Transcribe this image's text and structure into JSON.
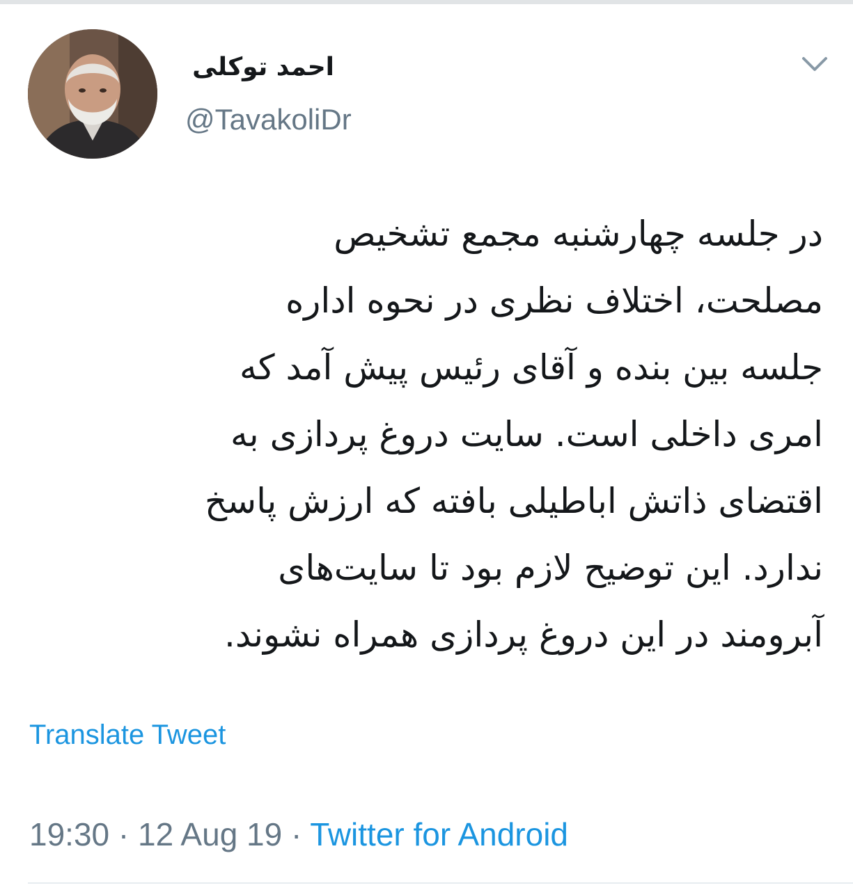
{
  "user": {
    "display_name": "احمد توکلی",
    "handle": "@TavakoliDr"
  },
  "tweet": {
    "lines": [
      "در جلسه چهارشنبه مجمع تشخیص",
      "مصلحت، اختلاف نظری در نحوه اداره",
      "جلسه بین بنده و آقای رئیس  پیش آمد که",
      "امری داخلی است. سایت دروغ پردازی به",
      "اقتضای ذاتش اباطیلی بافته که ارزش پاسخ",
      "ندارد. این توضیح لازم بود تا سایت‌های",
      "آبرومند در این دروغ پردازی همراه نشوند."
    ],
    "translate_label": "Translate Tweet",
    "time": "19:30",
    "separator": "·",
    "date": "12 Aug 19",
    "source": "Twitter for Android"
  },
  "icons": {
    "menu": "chevron-down-icon",
    "avatar": "profile-photo"
  },
  "colors": {
    "link": "#1b95e0",
    "secondary_text": "#657786",
    "primary_text": "#14171a"
  }
}
